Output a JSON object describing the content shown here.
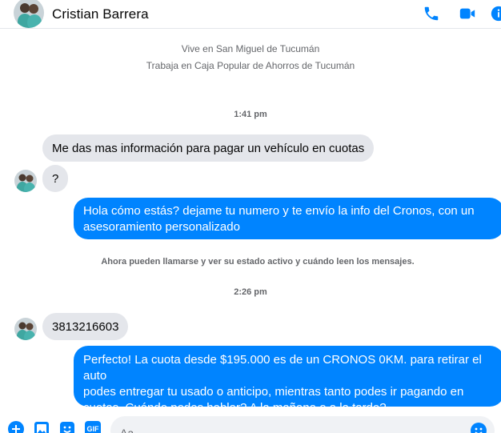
{
  "header": {
    "contact_name": "Cristian Barrera",
    "icons": [
      "phone-icon",
      "video-camera-icon",
      "info-icon"
    ],
    "accent": "#0084ff"
  },
  "profile": {
    "lives_in": "Vive en San Miguel de Tucumán",
    "works_at": "Trabaja en Caja Popular de Ahorros de Tucumán"
  },
  "messages": {
    "time_1": "1:41 pm",
    "in_1": "Me das mas información para pagar un vehículo en cuotas",
    "in_2": "?",
    "out_1_line_1": "Hola cómo estás? dejame tu numero  y te envío la info del Cronos, con un",
    "out_1_line_2": "asesoramiento personalizado",
    "notice": "Ahora pueden llamarse y ver su estado activo y cuándo leen los mensajes.",
    "time_2": "2:26 pm",
    "in_3": "3813216603",
    "out_2_line_1": "Perfecto! La cuota desde $195.000 es de un CRONOS 0KM. para retirar el auto",
    "out_2_line_2": "podes entregar tu usado o anticipo, mientras tanto podes ir pagando en",
    "out_2_line_3": "cuotas. Cuándo podes hablar? A la mañana o a la tarde?"
  },
  "composer": {
    "placeholder": "Aa",
    "icons": [
      "add-icon",
      "image-icon",
      "sticker-icon",
      "gif-icon",
      "emoji-icon"
    ],
    "gif_label": "GIF"
  },
  "colors": {
    "bubble_out": "#0084ff",
    "bubble_in": "#e4e6eb",
    "meta_text": "#65676b"
  }
}
